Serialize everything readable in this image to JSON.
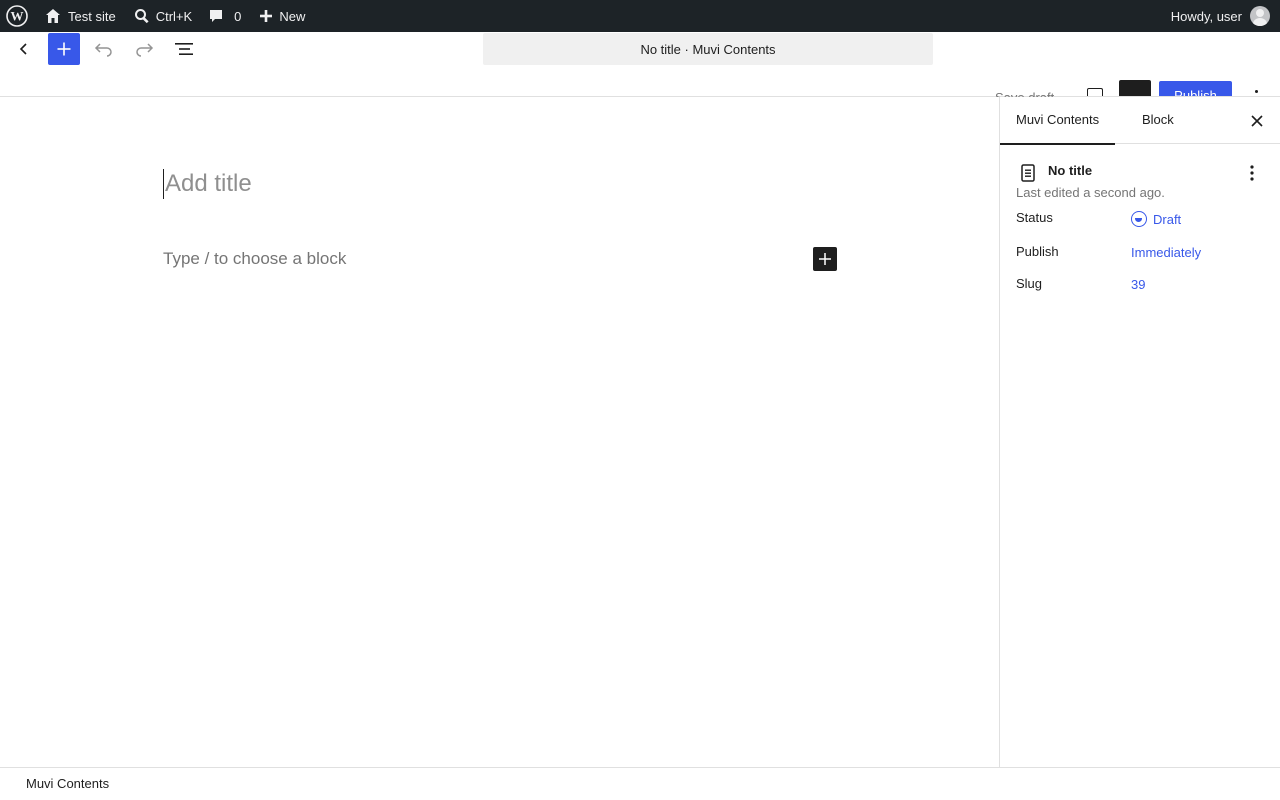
{
  "admin_bar": {
    "site_name": "Test site",
    "search_shortcut": "Ctrl+K",
    "comments_count": "0",
    "new_label": "New",
    "greeting": "Howdy, user"
  },
  "header": {
    "document_title": "No title · Muvi Contents",
    "save_draft_label": "Save draft",
    "publish_label": "Publish"
  },
  "canvas": {
    "title_placeholder": "Add title",
    "block_placeholder": "Type / to choose a block"
  },
  "sidebar": {
    "tabs": [
      "Muvi Contents",
      "Block"
    ],
    "post_title": "No title",
    "last_edited": "Last edited a second ago.",
    "rows": [
      {
        "label": "Status",
        "value": "Draft"
      },
      {
        "label": "Publish",
        "value": "Immediately"
      },
      {
        "label": "Slug",
        "value": "39"
      }
    ]
  },
  "footer": {
    "breadcrumb": "Muvi Contents"
  },
  "colors": {
    "accent": "#3858e9",
    "admin_bar_bg": "#1d2327",
    "text": "#1e1e1e"
  }
}
